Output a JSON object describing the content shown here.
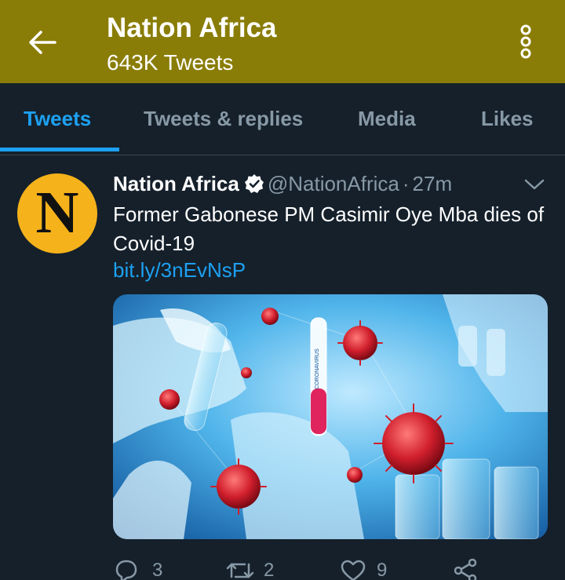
{
  "header": {
    "title": "Nation Africa",
    "subtitle": "643K Tweets",
    "back_icon": "arrow-left-icon",
    "more_icon": "more-vertical-icon",
    "background": "#8a7d07"
  },
  "tabs": [
    {
      "label": "Tweets",
      "active": true
    },
    {
      "label": "Tweets & replies",
      "active": false
    },
    {
      "label": "Media",
      "active": false
    },
    {
      "label": "Likes",
      "active": false
    }
  ],
  "tweet": {
    "avatar_letter": "N",
    "name": "Nation Africa",
    "handle": "@NationAfrica",
    "separator": "·",
    "time": "27m",
    "text": "Former Gabonese PM Casimir Oye Mba dies of Covid-19",
    "link": "bit.ly/3nEvNsP",
    "image_label": "CORONAVIRUS",
    "actions": {
      "replies": "3",
      "retweets": "2",
      "likes": "9"
    }
  },
  "colors": {
    "accent": "#1da1f2",
    "background": "#15202b",
    "muted": "#8899a6",
    "avatar_bg": "#f5b21a"
  }
}
